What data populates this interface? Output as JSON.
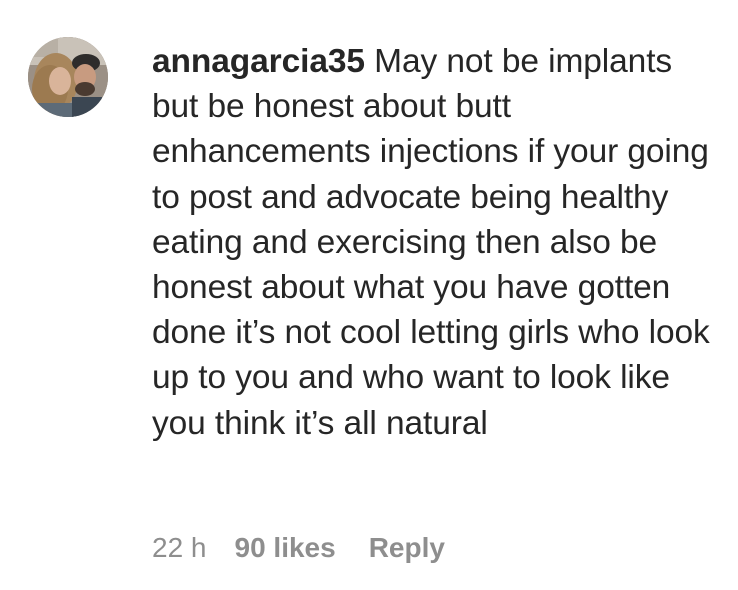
{
  "comment": {
    "username": "annagarcia35",
    "text": "May not be implants but be honest about butt enhancements injections if your going to post and advocate being healthy eating and exercising then also be honest about what you have gotten done it’s not cool letting girls who look up to you and who want to look like you think it’s all natural",
    "timestamp": "22 h",
    "likes": "90 likes",
    "reply_label": "Reply"
  },
  "avatar": {
    "icon": "profile-photo"
  },
  "colors": {
    "text": "#262626",
    "secondary": "#8e8e8e",
    "background": "#ffffff"
  }
}
